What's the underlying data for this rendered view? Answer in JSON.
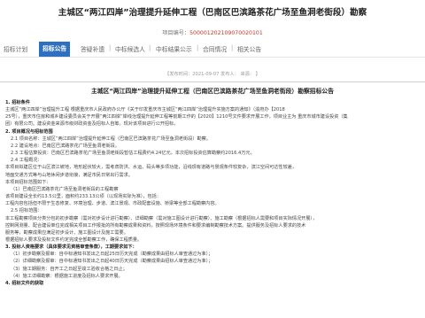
{
  "page": {
    "title": "主城区“两江四岸”治理提升延伸工程（巴南区巴滨路茶花广场至鱼洞老街段）勘察",
    "project_no_label": "项目编号：",
    "project_no": "500001202109070020101"
  },
  "tabs": [
    {
      "label": "招标计划"
    },
    {
      "label": "招标公告"
    },
    {
      "label": "答疑补遗"
    },
    {
      "label": "中标候选人"
    },
    {
      "label": "中标结果公示"
    },
    {
      "label": "合同情况"
    },
    {
      "label": "相关公告"
    }
  ],
  "meta": "【发布时间：2021-09-07 发布人：  来源：  】",
  "notice": {
    "heading": "主城区“两江四岸”治理提升延伸工程（巴南区巴滨路茶花广场至鱼洞老街段）勘察招标公告",
    "lines": [
      {
        "text": "1. 招标条件",
        "section": true
      },
      {
        "text": "主城区“两江四岸”治理提升工程 根据重庆市人民政府办公厅《关于印发重庆市主城区“两江四岸”治理提升实施方案的通知》（渝府办【2018",
        "section": false
      },
      {
        "text": "25号），重庆市住房和城乡建设委员会关于开展“两江四岸”岸线治理提升延伸工程等前期工作的【2020】1210号文件要求开展工作，项目业主为 重庆市城市建设投资（集",
        "section": false
      },
      {
        "text": "团）有限公司。建设资金来源市级财政资金及招标人自筹。现对该项目进行公开招标。",
        "section": false
      },
      {
        "text": "2. 项目概况与招标范围",
        "section": true
      },
      {
        "text": "2.1  项目名称：主城区“两江四岸”治理提升延伸工程（巴南区巴滨路茶花广场至鱼洞老街段）勘察。",
        "section": false,
        "item": true
      },
      {
        "text": "2.2  建设地点：巴南区巴滨路茶花广场至鱼洞老街段。",
        "section": false,
        "item": true
      },
      {
        "text": "2.3  工程估算投资：巴南区巴滨路茶花广场至鱼洞老街段暂估工程费约4.24亿元，本次招标投资估算勘察约2016.4万元。",
        "section": false,
        "item": true
      },
      {
        "text": "2.4  工程概况：",
        "section": false,
        "item": true
      },
      {
        "text": "本项目拟建区位于山区滨江坡地，地形起伏较大，需考虑防洪、水运、码头等多项功能，沿线现有道路与景观条件较复杂，滨江空间可达性较差，",
        "section": false
      },
      {
        "text": "地面交通方式等与山地休闲步道衔接，满足市民日常出行需求。",
        "section": false
      },
      {
        "text": "本项目招标范围如下：",
        "section": false
      },
      {
        "text": "（1）巴南区巴滨路茶花广场至鱼洞老街段的工程勘察",
        "section": false,
        "item": true
      },
      {
        "text": "该项目建设全长约13.5公里，面积约233.13公顷（以现场实际为准），包括：",
        "section": false
      },
      {
        "text": "工程内容包括但不限于生态修复、环境治理、步道、滨江景观、市政配套设施、桥梁等全部工程勘察内容。",
        "section": false
      },
      {
        "text": "2.5  招标范围：",
        "section": false,
        "item": true
      },
      {
        "text": "本工程勘察项目分类分包的初步勘察（需对初步设计进行勘察）、详细勘察（需对施工图设计进行勘察）、施工勘察（根据招标人需要和项目实际情况开展），",
        "section": false
      },
      {
        "text": "控制网测量、配合建设单位完成相关项目工作报批的所有勘察成果和资料，按照现场环境条件和要求编制勘察技术方案。提供服务及招标人要求的技术",
        "section": false
      },
      {
        "text": "服务等，勘察成果应满足初步设计、施工图设计及施工需要。",
        "section": false
      },
      {
        "text": "根据招标人要求及投标文件约定完成全部勘察工作，确保工程质量。",
        "section": false
      },
      {
        "text": "3. 投标人资格要求（具体要求见资格审查条款），工期要求如下：",
        "section": true
      },
      {
        "text": "（1）初步勘察及报审：自中标通知书发出之日起25日历天完成（勘察成果由招标人审查通过为准）；",
        "section": false,
        "item": true
      },
      {
        "text": "（2）详细勘察及报审：自中标通知书发出之日起40日历天完成（勘察成果由招标人审查通过为准）；",
        "section": false,
        "item": true
      },
      {
        "text": "（3）施工期服务：自开工之日起至竣工验收合格之日止；",
        "section": false,
        "item": true
      },
      {
        "text": "（4）施工详细勘察：根据施工进度及招标人要求开展。",
        "section": false,
        "item": true
      },
      {
        "text": "4. 招标文件的获取",
        "section": true
      }
    ]
  }
}
